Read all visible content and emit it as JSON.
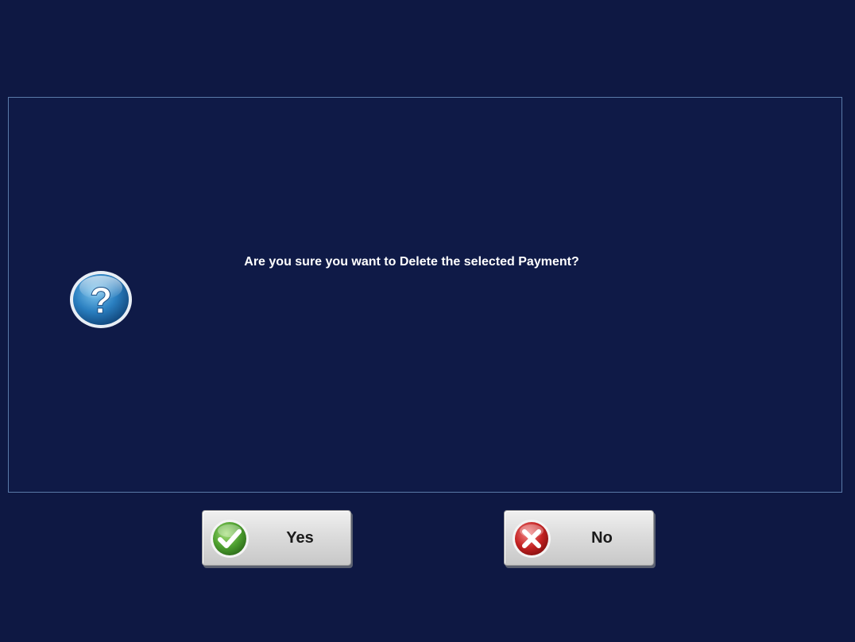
{
  "dialog": {
    "message": "Are you sure you want to Delete the selected Payment?",
    "icon": "question-icon"
  },
  "buttons": {
    "yes": {
      "label": "Yes",
      "icon": "check-icon"
    },
    "no": {
      "label": "No",
      "icon": "close-icon"
    }
  },
  "colors": {
    "background": "#0e1843",
    "panel_border": "#5a7aa8",
    "message_text": "#ffffff",
    "button_face": "#dcdcdc"
  }
}
